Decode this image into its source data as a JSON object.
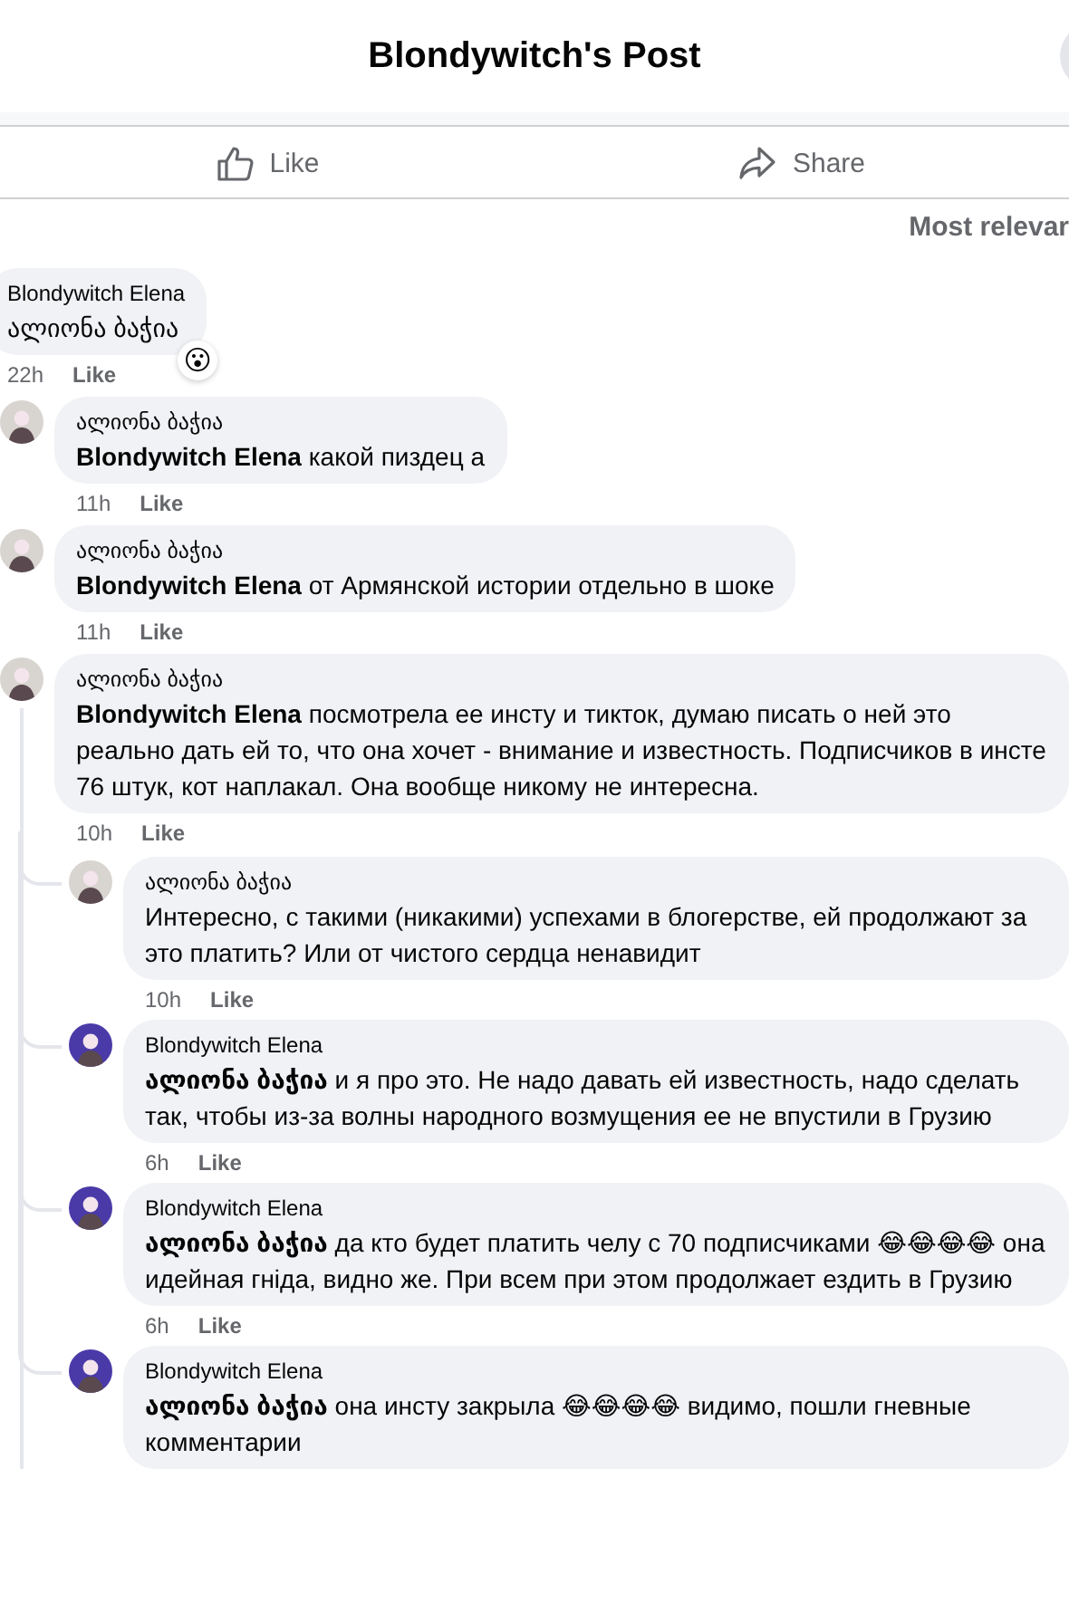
{
  "header": {
    "title": "Blondywitch's Post"
  },
  "actions": [
    {
      "kind": "like",
      "label": "Like"
    },
    {
      "kind": "share",
      "label": "Share"
    }
  ],
  "sort": {
    "label": "Most relevar"
  },
  "comments": [
    {
      "author": "Blondywitch Elena",
      "text": "ალიონა ბაჭია",
      "reaction": "😮",
      "time": "22h",
      "like": "Like"
    },
    {
      "author": "ალიონა ბაჭია",
      "color": "#d8d4cf",
      "text": "**Blondywitch Elena** какой пиздец а",
      "time": "11h",
      "like": "Like"
    },
    {
      "author": "ალიონა ბაჭია",
      "color": "#d8d4cf",
      "text": "**Blondywitch Elena** от Армянской истории отдельно в шоке",
      "time": "11h",
      "like": "Like"
    },
    {
      "author": "ალიონა ბაჭია",
      "color": "#d8d4cf",
      "text": "**Blondywitch Elena** посмотрела ее инсту и тикток, думаю писать о ней это реально дать ей то, что она хочет - внимание и известность. Подписчиков в инсте 76 штук, кот наплакал. Она вообще никому не интересна.",
      "time": "10h",
      "like": "Like",
      "children": [
        {
          "author": "ალიონა ბაჭია",
          "color": "#d8d4cf",
          "text": "Интересно, с такими (никакими) успехами в блогерстве, ей продолжают за это платить? Или от чистого сердца ненавидит",
          "time": "10h",
          "like": "Like"
        },
        {
          "author": "Blondywitch Elena",
          "color": "#4a3aa8",
          "text": "**ალიონა ბაჭია** и я про это. Не надо давать ей известность, надо сделать так, чтобы из-за волны народного возмущения ее не впустили в Грузию",
          "time": "6h",
          "like": "Like"
        },
        {
          "author": "Blondywitch Elena",
          "color": "#4a3aa8",
          "text": "**ალიონა ბაჭია** да кто будет платить челу с 70 подписчиками 😂😂😂😂 она идейная гніда, видно же. При всем при этом продолжает ездить в Грузию",
          "time": "6h",
          "like": "Like"
        },
        {
          "author": "Blondywitch Elena",
          "color": "#4a3aa8",
          "text": "**ალიონა ბაჭია** она инсту закрыла 😂😂😂😂 видимо, пошли гневные комментарии"
        }
      ]
    }
  ]
}
